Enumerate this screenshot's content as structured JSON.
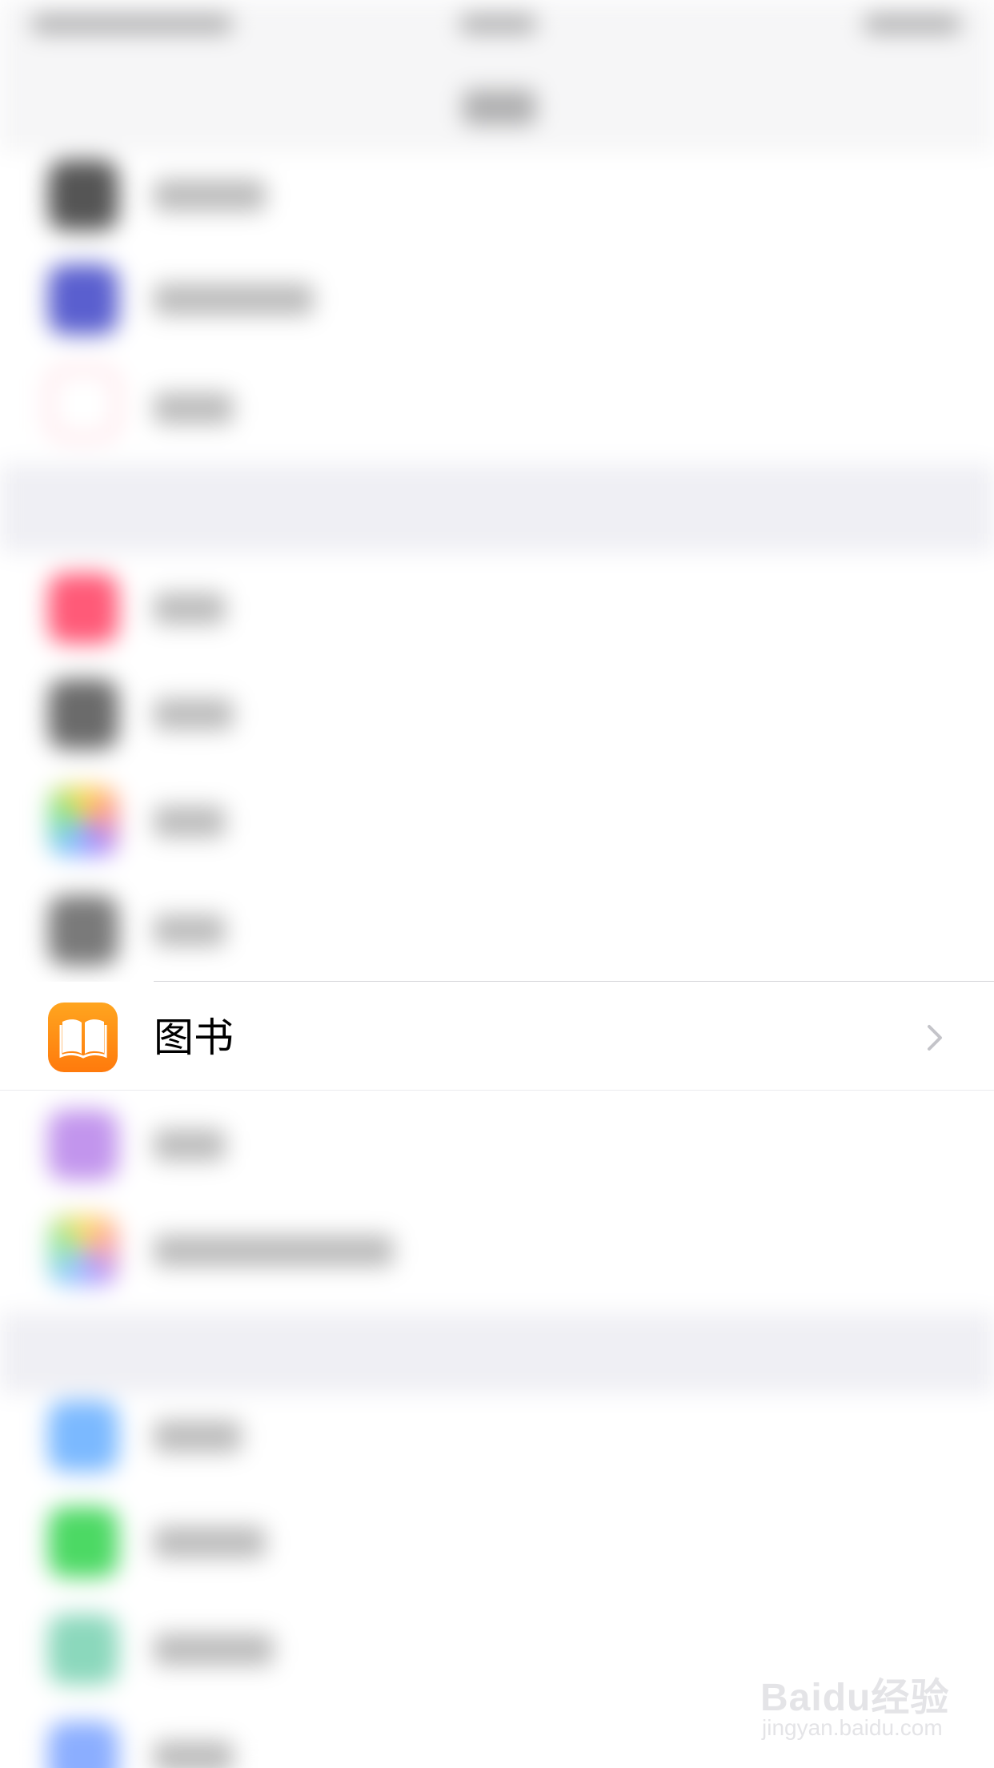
{
  "focused_row": {
    "label": "图书",
    "icon": "books-icon",
    "chevron_icon": "chevron-right-icon"
  },
  "colors": {
    "books_icon_top": "#ffa51f",
    "books_icon_bottom": "#ff7a0c",
    "chevron": "#c4c4c9",
    "group_gap": "#efeff4"
  },
  "blurred_rows": [
    {
      "icon": "app-icon",
      "color": "#555555"
    },
    {
      "icon": "app-icon",
      "color": "#5a5fcf"
    },
    {
      "icon": "app-icon",
      "color": "#ff4d6d"
    },
    {
      "icon": "app-icon",
      "color": "#ff5a78"
    },
    {
      "icon": "app-icon",
      "color": "#6b6b6b"
    },
    {
      "icon": "app-icon",
      "color": "#f0c040"
    },
    {
      "icon": "app-icon",
      "color": "#7a7a7a"
    },
    {
      "icon": "app-icon",
      "color": "#b37be8"
    },
    {
      "icon": "app-icon",
      "color": "#4fa0ff"
    },
    {
      "icon": "app-icon",
      "color": "#5aa8ff"
    },
    {
      "icon": "app-icon",
      "color": "#4cd964"
    },
    {
      "icon": "app-icon",
      "color": "#5ac8a0"
    },
    {
      "icon": "app-icon",
      "color": "#5a8cff"
    }
  ],
  "watermark": {
    "main": "Baidu经验",
    "sub": "jingyan.baidu.com"
  }
}
